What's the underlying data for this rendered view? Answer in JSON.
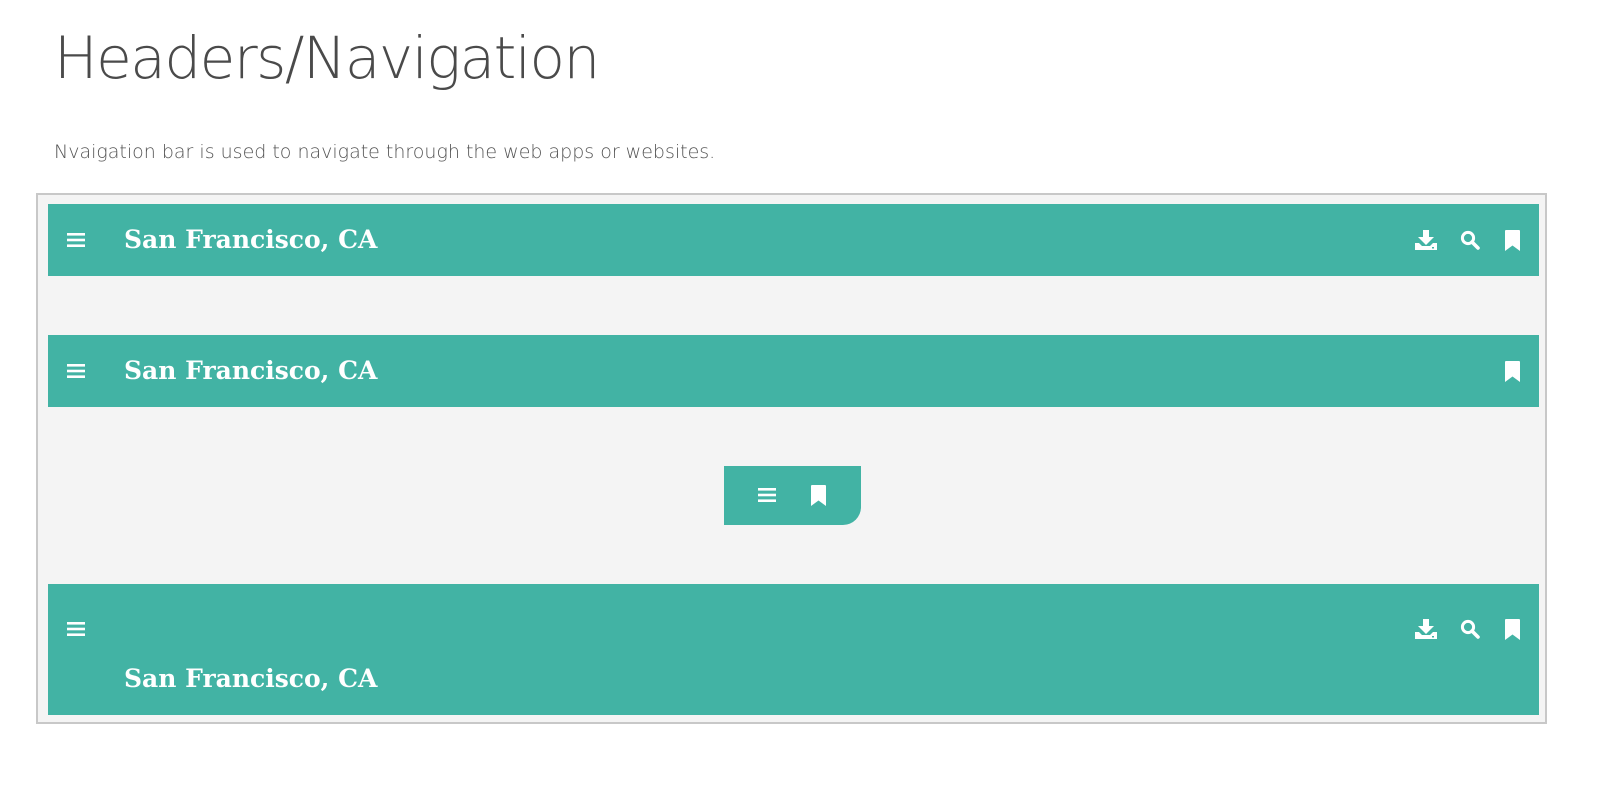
{
  "page": {
    "title": "Headers/Navigation",
    "description": "Nvaigation bar is used to navigate through the web apps or websites."
  },
  "colors": {
    "accent": "#42b3a4",
    "demo_background": "#f4f4f4",
    "icon": "#ffffff"
  },
  "navbars": [
    {
      "title": "San Francisco, CA",
      "left_icon": "menu-icon",
      "right_icons": [
        "download-icon",
        "search-icon",
        "bookmark-icon"
      ]
    },
    {
      "title": "San Francisco, CA",
      "left_icon": "menu-icon",
      "right_icons": [
        "bookmark-icon"
      ]
    },
    {
      "title": "",
      "left_icon": "menu-icon",
      "right_icons": [
        "bookmark-icon"
      ],
      "variant": "compact-floating"
    },
    {
      "title": "San Francisco, CA",
      "left_icon": "menu-icon",
      "right_icons": [
        "download-icon",
        "search-icon",
        "bookmark-icon"
      ],
      "variant": "prominent"
    }
  ]
}
